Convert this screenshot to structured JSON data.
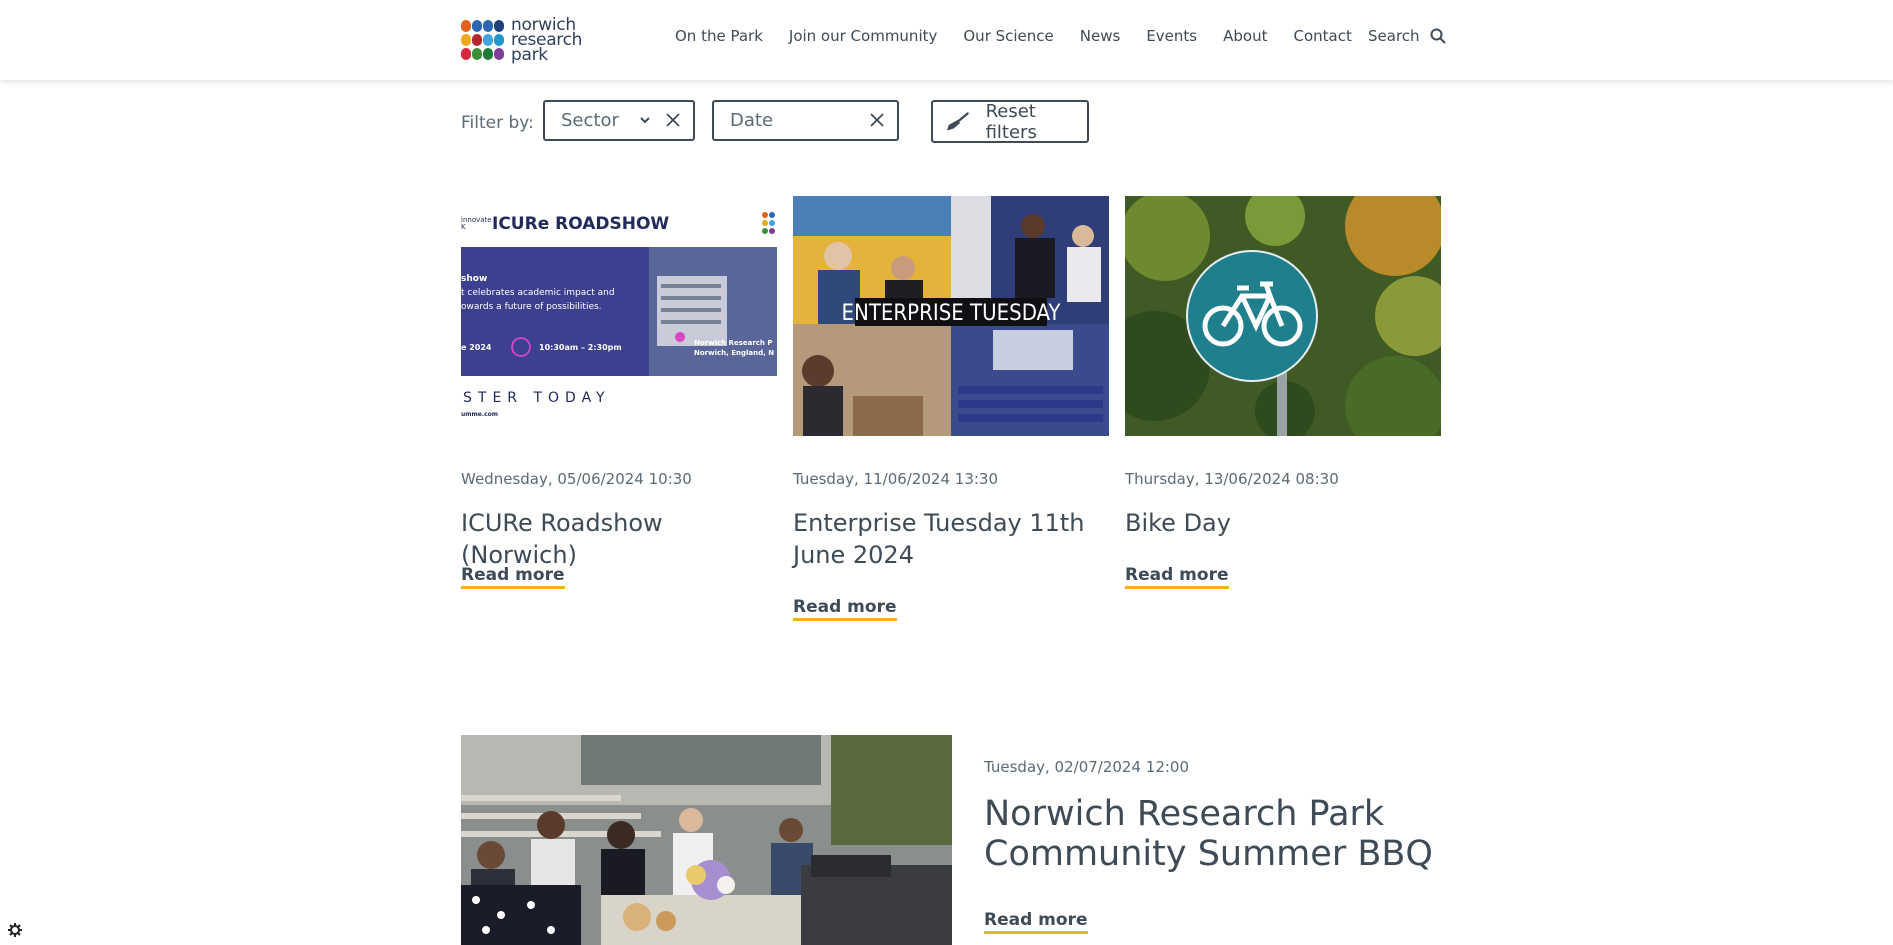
{
  "header": {
    "logo_lines": [
      "norwich",
      "research",
      "park"
    ],
    "nav": [
      "On the Park",
      "Join our Community",
      "Our Science",
      "News",
      "Events",
      "About",
      "Contact"
    ],
    "search_label": "Search"
  },
  "filters": {
    "label": "Filter by:",
    "sector": "Sector",
    "date": "Date",
    "reset": "Reset filters"
  },
  "events": [
    {
      "date": "Wednesday, 05/06/2024 10:30",
      "title": "ICURe Roadshow (Norwich)",
      "read_more": "Read more",
      "image": {
        "header": "ICURe ROADSHOW",
        "innovate": "innovate",
        "innovate_k": "K",
        "show": "show",
        "line1": "t celebrates academic impact and",
        "line2": "owards a future of possibilities.",
        "year": "e 2024",
        "time": "10:30am – 2:30pm",
        "place1": "Norwich Research P",
        "place2": "Norwich, England, N",
        "register": "STER TODAY",
        "url": "umme.com"
      }
    },
    {
      "date": "Tuesday, 11/06/2024 13:30",
      "title": "Enterprise Tuesday 11th June 2024",
      "read_more": "Read more",
      "image": {
        "banner": "ENTERPRISE TUESDAY"
      }
    },
    {
      "date": "Thursday, 13/06/2024 08:30",
      "title": "Bike Day",
      "read_more": "Read more"
    }
  ],
  "featured": {
    "date": "Tuesday, 02/07/2024 12:00",
    "title": "Norwich Research Park Community Summer BBQ",
    "read_more": "Read more"
  },
  "colors": {
    "accent_underline": "#f2b21b",
    "text": "#3e4b57"
  },
  "icons": [
    "search-icon",
    "chevron-down-icon",
    "close-icon",
    "broom-icon",
    "cookie-settings-icon"
  ]
}
